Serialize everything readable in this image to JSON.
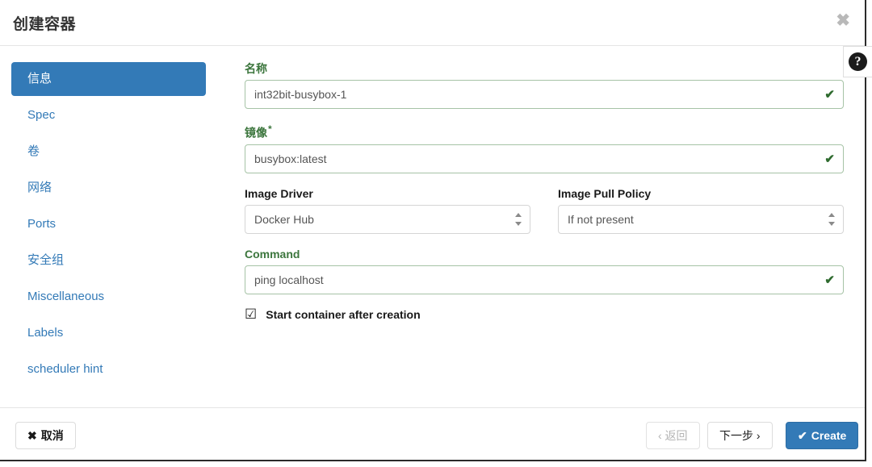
{
  "modal": {
    "title": "创建容器",
    "close_icon": "✖",
    "help_icon": "?"
  },
  "sidebar": {
    "items": [
      {
        "label": "信息",
        "active": true
      },
      {
        "label": "Spec",
        "active": false
      },
      {
        "label": "卷",
        "active": false
      },
      {
        "label": "网络",
        "active": false
      },
      {
        "label": "Ports",
        "active": false
      },
      {
        "label": "安全组",
        "active": false
      },
      {
        "label": "Miscellaneous",
        "active": false
      },
      {
        "label": "Labels",
        "active": false
      },
      {
        "label": "scheduler hint",
        "active": false
      }
    ]
  },
  "form": {
    "name": {
      "label": "名称",
      "value": "int32bit-busybox-1",
      "valid_icon": "✔"
    },
    "image": {
      "label": "镜像",
      "required_marker": "*",
      "value": "busybox:latest",
      "valid_icon": "✔"
    },
    "image_driver": {
      "label": "Image Driver",
      "value": "Docker Hub"
    },
    "image_pull_policy": {
      "label": "Image Pull Policy",
      "value": "If not present"
    },
    "command": {
      "label": "Command",
      "value": "ping localhost",
      "valid_icon": "✔"
    },
    "start_after_creation": {
      "label": "Start container after creation",
      "checkbox_glyph": "☑",
      "checked": true
    }
  },
  "footer": {
    "cancel": {
      "glyph": "✖",
      "label": "取消"
    },
    "back": {
      "label": "‹ 返回"
    },
    "next": {
      "label": "下一步 ›"
    },
    "create": {
      "glyph": "✔",
      "label": "Create"
    }
  },
  "colors": {
    "accent_blue": "#337ab7",
    "success_green": "#3c763d",
    "input_green_border": "#a6c3a6"
  }
}
